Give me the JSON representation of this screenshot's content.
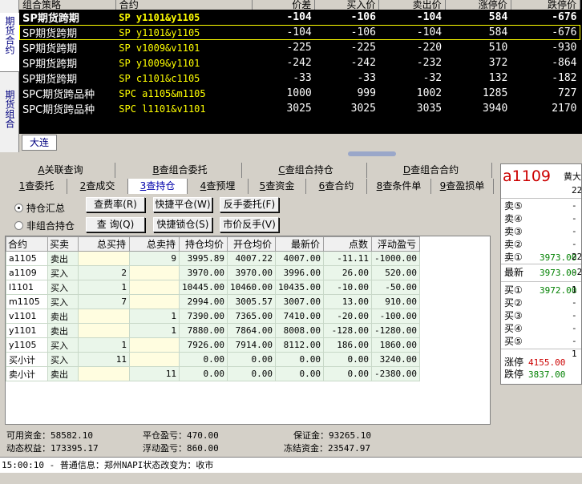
{
  "left_tabs": [
    "期货合约",
    "期货组合"
  ],
  "market": {
    "headers": [
      "组合策略",
      "合约",
      "价差",
      "买入价",
      "卖出价",
      "涨停价",
      "跌停价"
    ],
    "rows": [
      {
        "strategy": "SP期货跨期",
        "contract": "SP  y1101&y1105",
        "spread": "-104",
        "bid": "-106",
        "ask": "-104",
        "upper": "584",
        "lower": "-676"
      },
      {
        "strategy": "SP期货跨期",
        "contract": "SP  y1101&y1105",
        "spread": "-104",
        "bid": "-106",
        "ask": "-104",
        "upper": "584",
        "lower": "-676"
      },
      {
        "strategy": "SP期货跨期",
        "contract": "SP  v1009&v1101",
        "spread": "-225",
        "bid": "-225",
        "ask": "-220",
        "upper": "510",
        "lower": "-930"
      },
      {
        "strategy": "SP期货跨期",
        "contract": "SP  y1009&y1101",
        "spread": "-242",
        "bid": "-242",
        "ask": "-232",
        "upper": "372",
        "lower": "-864"
      },
      {
        "strategy": "SP期货跨期",
        "contract": "SP  c1101&c1105",
        "spread": "-33",
        "bid": "-33",
        "ask": "-32",
        "upper": "132",
        "lower": "-182"
      },
      {
        "strategy": "SPC期货跨品种",
        "contract": "SPC  a1105&m1105",
        "spread": "1000",
        "bid": "999",
        "ask": "1002",
        "upper": "1285",
        "lower": "727"
      },
      {
        "strategy": "SPC期货跨品种",
        "contract": "SPC  l1101&v1101",
        "spread": "3025",
        "bid": "3025",
        "ask": "3035",
        "upper": "3940",
        "lower": "2170"
      }
    ]
  },
  "exchange_tab": "大连",
  "func_tabs_row1": [
    {
      "key": "A",
      "label": "关联查询"
    },
    {
      "key": "B",
      "label": "查组合委托"
    },
    {
      "key": "C",
      "label": "查组合持仓"
    },
    {
      "key": "D",
      "label": "查组合合约"
    }
  ],
  "func_tabs_row2": [
    {
      "key": "1",
      "label": "查委托"
    },
    {
      "key": "2",
      "label": "查成交"
    },
    {
      "key": "3",
      "label": "查持仓"
    },
    {
      "key": "4",
      "label": "查预埋"
    },
    {
      "key": "5",
      "label": "查资金"
    },
    {
      "key": "6",
      "label": "查合约"
    },
    {
      "key": "8",
      "label": "查条件单"
    },
    {
      "key": "9",
      "label": "查盈损单"
    }
  ],
  "radios": {
    "holding_summary": "持仓汇总",
    "non_combo": "非组合持仓"
  },
  "buttons": {
    "fee_rate": "查费率(R)",
    "query": "查 询(Q)",
    "quick_close": "快捷平仓(W)",
    "quick_lock": "快捷锁仓(S)",
    "reverse_order": "反手委托(F)",
    "market_reverse": "市价反手(V)"
  },
  "positions": {
    "headers": [
      "合约",
      "买卖",
      "总买持",
      "总卖持",
      "持仓均价",
      "开仓均价",
      "最新价",
      "点数",
      "浮动盈亏"
    ],
    "rows": [
      {
        "contract": "a1105",
        "dir": "卖出",
        "buy": "",
        "sell": "9",
        "hold_avg": "3995.89",
        "open_avg": "4007.22",
        "last": "4007.00",
        "points": "-11.11",
        "pnl": "-1000.00"
      },
      {
        "contract": "a1109",
        "dir": "买入",
        "buy": "2",
        "sell": "",
        "hold_avg": "3970.00",
        "open_avg": "3970.00",
        "last": "3996.00",
        "points": "26.00",
        "pnl": "520.00"
      },
      {
        "contract": "l1101",
        "dir": "买入",
        "buy": "1",
        "sell": "",
        "hold_avg": "10445.00",
        "open_avg": "10460.00",
        "last": "10435.00",
        "points": "-10.00",
        "pnl": "-50.00"
      },
      {
        "contract": "m1105",
        "dir": "买入",
        "buy": "7",
        "sell": "",
        "hold_avg": "2994.00",
        "open_avg": "3005.57",
        "last": "3007.00",
        "points": "13.00",
        "pnl": "910.00"
      },
      {
        "contract": "v1101",
        "dir": "卖出",
        "buy": "",
        "sell": "1",
        "hold_avg": "7390.00",
        "open_avg": "7365.00",
        "last": "7410.00",
        "points": "-20.00",
        "pnl": "-100.00"
      },
      {
        "contract": "y1101",
        "dir": "卖出",
        "buy": "",
        "sell": "1",
        "hold_avg": "7880.00",
        "open_avg": "7864.00",
        "last": "8008.00",
        "points": "-128.00",
        "pnl": "-1280.00"
      },
      {
        "contract": "y1105",
        "dir": "买入",
        "buy": "1",
        "sell": "",
        "hold_avg": "7926.00",
        "open_avg": "7914.00",
        "last": "8112.00",
        "points": "186.00",
        "pnl": "1860.00"
      },
      {
        "contract": "买小计",
        "dir": "买入",
        "buy": "11",
        "sell": "",
        "hold_avg": "0.00",
        "open_avg": "0.00",
        "last": "0.00",
        "points": "0.00",
        "pnl": "3240.00"
      },
      {
        "contract": "卖小计",
        "dir": "卖出",
        "buy": "",
        "sell": "11",
        "hold_avg": "0.00",
        "open_avg": "0.00",
        "last": "0.00",
        "points": "0.00",
        "pnl": "-2380.00"
      }
    ]
  },
  "account": {
    "available_label": "可用资金：",
    "available": "58582.10",
    "dynamic_label": "动态权益：",
    "dynamic": "173395.17",
    "close_pnl_label": "平仓盈亏：",
    "close_pnl": "470.00",
    "float_pnl_label": "浮动盈亏：",
    "float_pnl": "860.00",
    "margin_label": "保证金：",
    "margin": "93265.10",
    "frozen_label": "冻结资金：",
    "frozen": "23547.97"
  },
  "quote": {
    "code": "a1109",
    "name": "黄大",
    "small": "22",
    "asks": [
      {
        "label": "卖⑤",
        "price": "",
        "vol": "-"
      },
      {
        "label": "卖④",
        "price": "",
        "vol": "-"
      },
      {
        "label": "卖③",
        "price": "",
        "vol": "-"
      },
      {
        "label": "卖②",
        "price": "",
        "vol": "-"
      },
      {
        "label": "卖①",
        "price": "3973.00",
        "vol": "22"
      }
    ],
    "last_label": "最新",
    "last": "3973.00",
    "last_vol": "-2",
    "bids": [
      {
        "label": "买①",
        "price": "3972.00",
        "vol": "1"
      },
      {
        "label": "买②",
        "price": "",
        "vol": "-"
      },
      {
        "label": "买③",
        "price": "",
        "vol": "-"
      },
      {
        "label": "买④",
        "price": "",
        "vol": "-"
      },
      {
        "label": "买⑤",
        "price": "",
        "vol": "-"
      }
    ],
    "extra_vol": "1",
    "upper_label": "涨停",
    "upper": "4155.00",
    "lower_label": "跌停",
    "lower": "3837.00"
  },
  "colors": {
    "upper": "#cc0000",
    "lower": "#008000",
    "code": "#cc0000"
  },
  "status_text": "15:00:10 - 普通信息：郑州NAPI状态改变为：收市"
}
